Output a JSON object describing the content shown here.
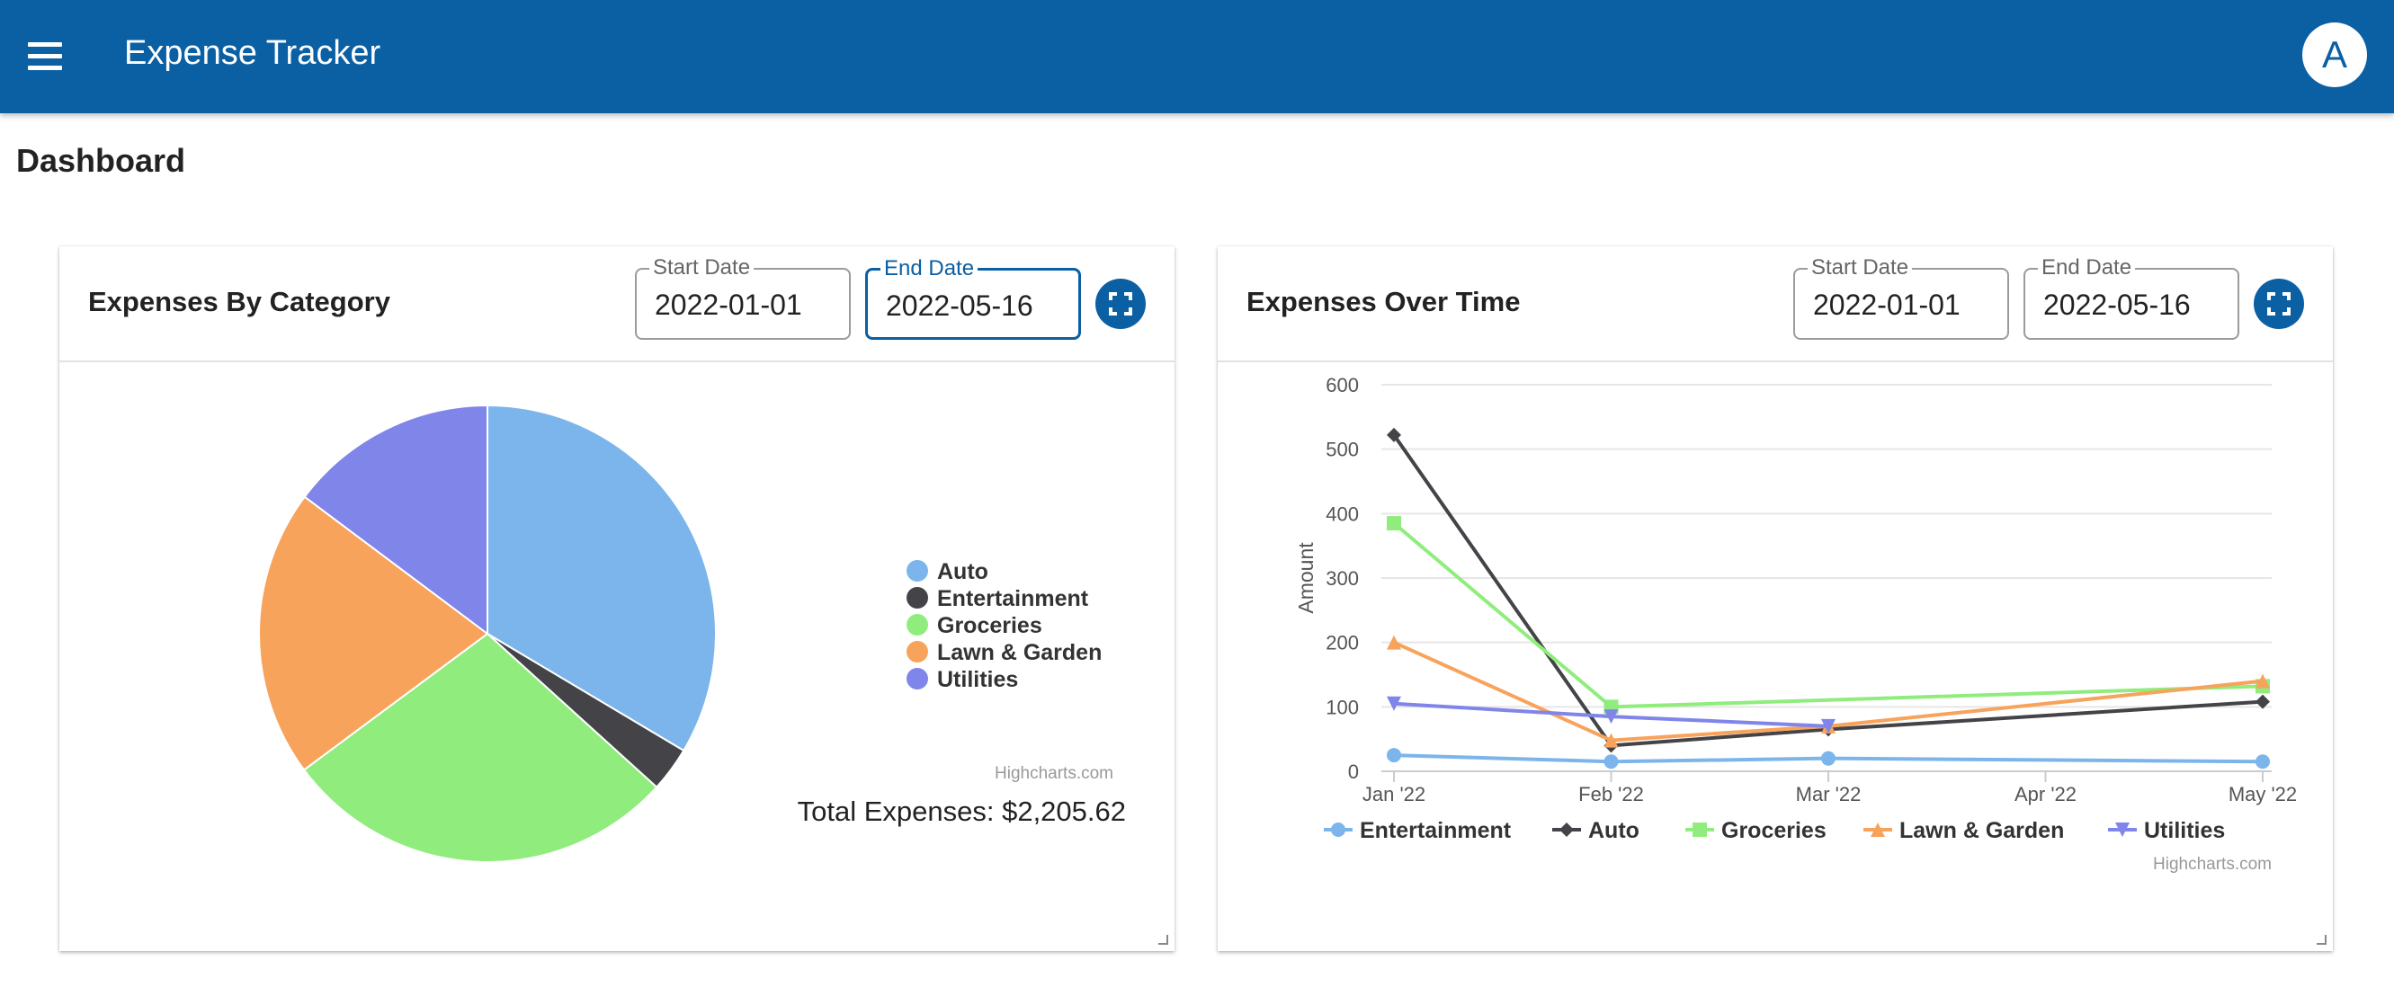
{
  "app": {
    "title": "Expense Tracker",
    "avatar_letter": "A"
  },
  "icons": {
    "menu": "menu-icon",
    "fullscreen": "fullscreen-icon",
    "resize": "resize-handle-icon"
  },
  "colors": {
    "appbar": "#0b5fa3",
    "accent": "#0b5fa3"
  },
  "page": {
    "title": "Dashboard"
  },
  "cards": [
    {
      "title": "Expenses By Category",
      "start_label": "Start Date",
      "start_value": "2022-01-01",
      "end_label": "End Date",
      "end_value": "2022-05-16",
      "credits": "Highcharts.com",
      "total_text": "Total Expenses: $2,205.62"
    },
    {
      "title": "Expenses Over Time",
      "start_label": "Start Date",
      "start_value": "2022-01-01",
      "end_label": "End Date",
      "end_value": "2022-05-16",
      "credits": "Highcharts.com"
    }
  ],
  "chart_data": [
    {
      "type": "pie",
      "legend_position": "right",
      "slices": [
        {
          "name": "Auto",
          "value": 740,
          "color": "#7cb5ec"
        },
        {
          "name": "Entertainment",
          "value": 70,
          "color": "#434348"
        },
        {
          "name": "Groceries",
          "value": 620,
          "color": "#90ed7d"
        },
        {
          "name": "Lawn & Garden",
          "value": 450,
          "color": "#f7a35c"
        },
        {
          "name": "Utilities",
          "value": 325.62,
          "color": "#8085e9"
        }
      ]
    },
    {
      "type": "line",
      "legend_position": "bottom",
      "ylabel": "Amount",
      "ylim": [
        0,
        600
      ],
      "yticks": [
        0,
        100,
        200,
        300,
        400,
        500,
        600
      ],
      "categories": [
        "Jan '22",
        "Feb '22",
        "Mar '22",
        "Apr '22",
        "May '22"
      ],
      "series": [
        {
          "name": "Entertainment",
          "color": "#7cb5ec",
          "marker": "circle",
          "points": [
            {
              "x": 0,
              "y": 25
            },
            {
              "x": 1,
              "y": 15
            },
            {
              "x": 2,
              "y": 20
            },
            {
              "x": 4,
              "y": 15
            }
          ]
        },
        {
          "name": "Auto",
          "color": "#434348",
          "marker": "diamond",
          "points": [
            {
              "x": 0,
              "y": 522
            },
            {
              "x": 1,
              "y": 40
            },
            {
              "x": 2,
              "y": 65
            },
            {
              "x": 4,
              "y": 108
            }
          ]
        },
        {
          "name": "Groceries",
          "color": "#90ed7d",
          "marker": "square",
          "points": [
            {
              "x": 0,
              "y": 385
            },
            {
              "x": 1,
              "y": 100
            },
            {
              "x": 4,
              "y": 132
            }
          ]
        },
        {
          "name": "Lawn & Garden",
          "color": "#f7a35c",
          "marker": "triangle",
          "points": [
            {
              "x": 0,
              "y": 200
            },
            {
              "x": 1,
              "y": 48
            },
            {
              "x": 2,
              "y": 70
            },
            {
              "x": 4,
              "y": 140
            }
          ]
        },
        {
          "name": "Utilities",
          "color": "#8085e9",
          "marker": "triangle-down",
          "points": [
            {
              "x": 0,
              "y": 105
            },
            {
              "x": 1,
              "y": 85
            },
            {
              "x": 2,
              "y": 70
            }
          ]
        }
      ]
    }
  ]
}
